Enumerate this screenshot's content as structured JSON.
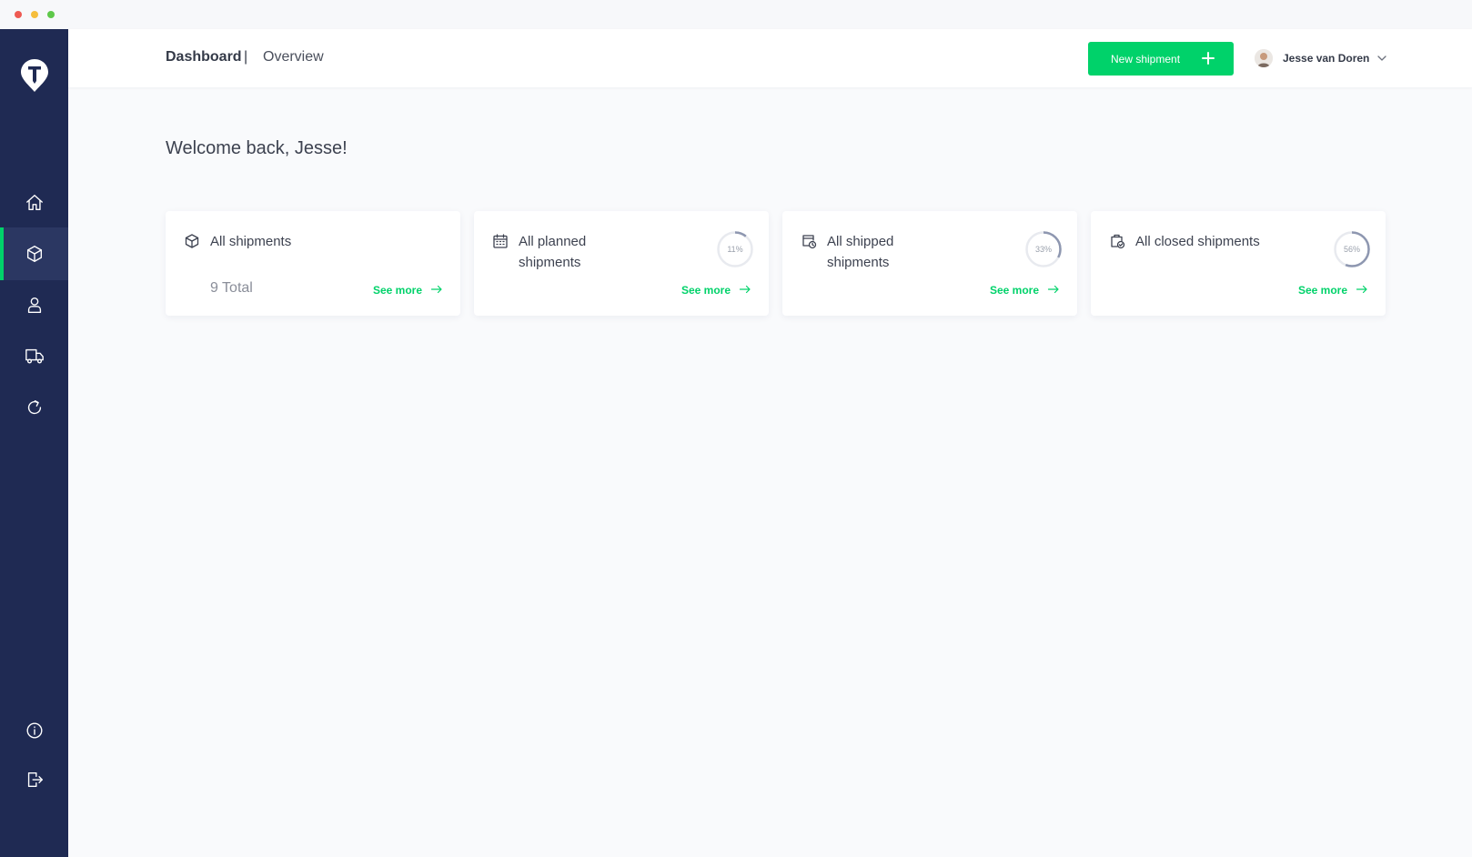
{
  "header": {
    "title": "Dashboard",
    "separator": "|",
    "subtitle": "Overview",
    "new_button_label": "New shipment",
    "user_name": "Jesse van Doren"
  },
  "welcome": "Welcome back, Jesse!",
  "colors": {
    "sidebar": "#1f2a53",
    "sidebar_active": "#2b3762",
    "accent": "#00d26a",
    "ring_track": "#e8eaef",
    "ring_fill": "#8e97b0"
  },
  "sidebar": {
    "items": [
      {
        "icon": "home-icon",
        "active": false
      },
      {
        "icon": "box-icon",
        "active": true
      },
      {
        "icon": "user-icon",
        "active": false
      },
      {
        "icon": "truck-icon",
        "active": false
      },
      {
        "icon": "refresh-icon",
        "active": false
      }
    ],
    "bottom_items": [
      {
        "icon": "info-icon"
      },
      {
        "icon": "logout-icon"
      }
    ]
  },
  "cards": [
    {
      "icon": "box-icon",
      "title": "All shipments",
      "total": "9 Total",
      "see_more": "See more"
    },
    {
      "icon": "calendar-icon",
      "title": "All planned shipments",
      "percent_label": "11%",
      "percent": 11,
      "see_more": "See more"
    },
    {
      "icon": "shipped-icon",
      "title": "All shipped shipments",
      "percent_label": "33%",
      "percent": 33,
      "see_more": "See more"
    },
    {
      "icon": "closed-icon",
      "title": "All closed shipments",
      "percent_label": "56%",
      "percent": 56,
      "see_more": "See more"
    }
  ]
}
